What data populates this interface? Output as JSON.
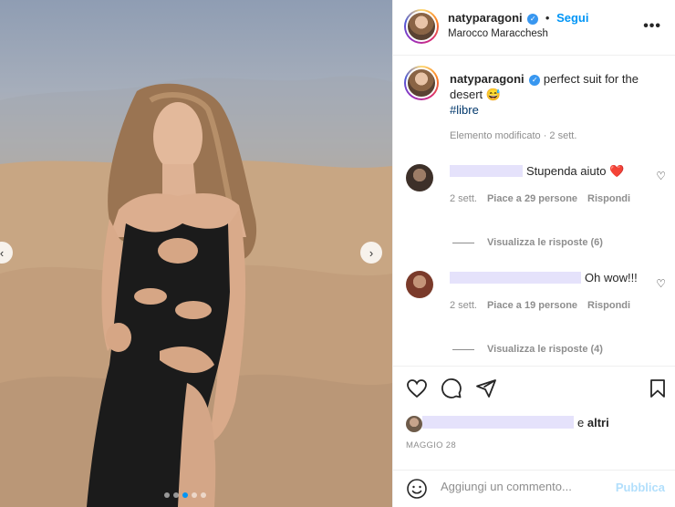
{
  "post": {
    "username": "natyparagoni",
    "verified_icon": "verified-badge-icon",
    "separator": "•",
    "follow_label": "Segui",
    "location": "Marocco Maracchesh",
    "caption_text": "perfect suit for the desert 😅",
    "hashtag": "#libre",
    "caption_meta": "Elemento modificato · 2 sett."
  },
  "comments": [
    {
      "text": "Stupenda aiuto ❤️",
      "time": "2 sett.",
      "likes": "Piace a 29 persone",
      "reply_label": "Rispondi",
      "view_replies": "Visualizza le risposte (6)"
    },
    {
      "text": "Oh wow!!!",
      "time": "2 sett.",
      "likes": "Piace a 19 persone",
      "reply_label": "Rispondi",
      "view_replies": "Visualizza le risposte (4)"
    }
  ],
  "likes_summary": {
    "suffix_and": "e",
    "suffix_others": "altri"
  },
  "date": "MAGGIO 28",
  "add_comment": {
    "placeholder": "Aggiungi un commento...",
    "publish_label": "Pubblica"
  },
  "carousel": {
    "prev_icon": "chevron-left-icon",
    "next_icon": "chevron-right-icon",
    "active_index": 2,
    "total": 5
  },
  "colors": {
    "accent": "#0095f6",
    "verified": "#3897f0",
    "publish_disabled": "#b2dffc",
    "redacted": "#e5e2fb"
  }
}
